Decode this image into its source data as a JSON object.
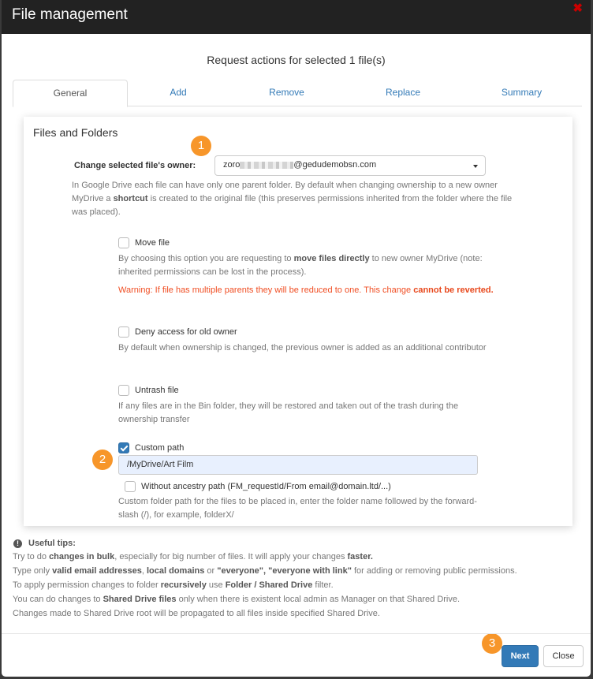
{
  "header": {
    "title": "File management",
    "close_icon": "close-x-icon"
  },
  "subtitle": "Request actions for selected 1 file(s)",
  "tabs": [
    {
      "label": "General",
      "active": true
    },
    {
      "label": "Add",
      "active": false
    },
    {
      "label": "Remove",
      "active": false
    },
    {
      "label": "Replace",
      "active": false
    },
    {
      "label": "Summary",
      "active": false
    }
  ],
  "panel": {
    "title": "Files and Folders",
    "owner": {
      "label": "Change selected file's owner:",
      "value_prefix": "zoro",
      "value_suffix": "@gedudemobsn.com",
      "help": {
        "p1": "In Google Drive each file can have only one parent folder. By default when changing ownership to a new owner MyDrive a ",
        "bold": "shortcut",
        "p2": " is created to the original file (this preserves permissions inherited from the folder where the file was placed)."
      }
    },
    "move_file": {
      "label": "Move file",
      "checked": false,
      "help_p1": "By choosing this option you are requesting to ",
      "help_bold": "move files directly",
      "help_p2": " to new owner MyDrive (note: inherited permissions can be lost in the process).",
      "warning_p1": "Warning: If file has multiple parents they will be reduced to one. This change ",
      "warning_bold": "cannot be reverted."
    },
    "deny_access": {
      "label": "Deny access for old owner",
      "checked": false,
      "help": "By default when ownership is changed, the previous owner is added as an additional contributor"
    },
    "untrash": {
      "label": "Untrash file",
      "checked": false,
      "help": "If any files are in the Bin folder, they will be restored and taken out of the trash during the ownership transfer"
    },
    "custom_path": {
      "label": "Custom path",
      "checked": true,
      "value": "/MyDrive/Art Film",
      "without_ancestry_label": "Without ancestry path (FM_requestId/From email@domain.ltd/...)",
      "without_ancestry_checked": false,
      "help": "Custom folder path for the files to be placed in, enter the folder name followed by the forward-slash (/), for example, folderX/"
    }
  },
  "badges": [
    "1",
    "2",
    "3"
  ],
  "tips": {
    "title": "Useful tips:",
    "icon": "info-circle-icon",
    "t1": {
      "a": "Try to do ",
      "b": "changes in bulk",
      "c": ", especially for big number of files. It will apply your changes ",
      "d": "faster."
    },
    "t2": {
      "a": "Type only ",
      "b": "valid email addresses",
      "c": ", ",
      "d": "local domains",
      "e": " or ",
      "f": "\"everyone\", \"everyone with link\"",
      "g": " for adding or removing public permissions."
    },
    "t3": {
      "a": "To apply permission changes to folder ",
      "b": "recursively",
      "c": " use ",
      "d": "Folder / Shared Drive",
      "e": " filter."
    },
    "t4": {
      "a": "You can do changes to ",
      "b": "Shared Drive files",
      "c": " only when there is existent local admin as Manager on that Shared Drive."
    },
    "t5": "Changes made to Shared Drive root will be propagated to all files inside specified Shared Drive."
  },
  "footer": {
    "next_label": "Next",
    "close_label": "Close"
  },
  "colors": {
    "accent": "#337ab7",
    "badge": "#f7962a",
    "warning": "#f04e23",
    "header_bg": "#222222",
    "close_icon": "#cc0000"
  }
}
